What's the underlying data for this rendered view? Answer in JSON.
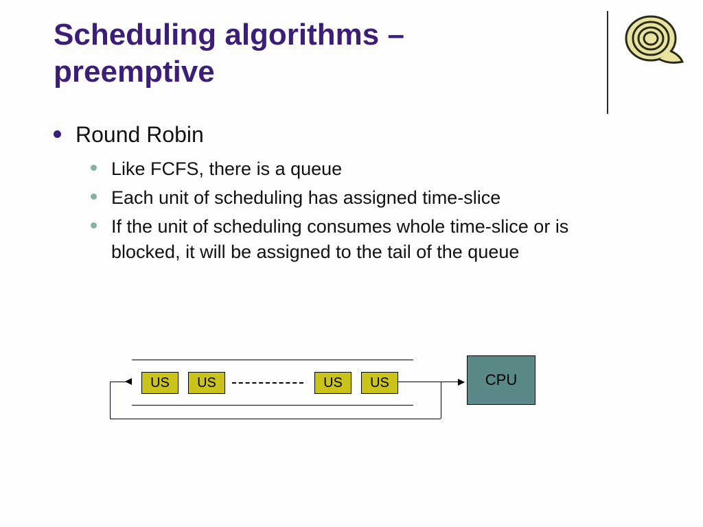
{
  "title": "Scheduling algorithms – preemptive",
  "icon_name": "snail-icon",
  "bullets": {
    "main": "Round Robin",
    "sub1": "Like FCFS, there is a queue",
    "sub2": "Each unit of scheduling has assigned time-slice",
    "sub3": "If the unit of scheduling consumes whole time-slice or is blocked, it will be assigned to the tail of the queue"
  },
  "diagram": {
    "queue_items": [
      "US",
      "US",
      "US",
      "US"
    ],
    "target_label": "CPU"
  }
}
